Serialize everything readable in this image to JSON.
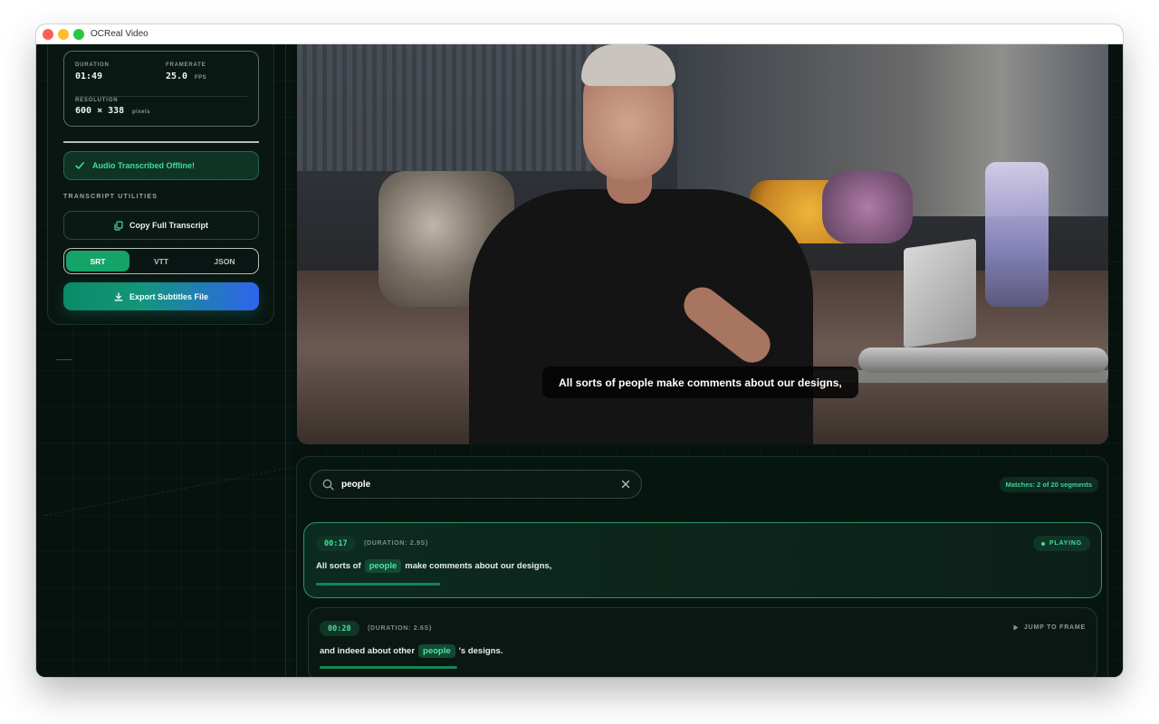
{
  "window": {
    "title": "OCReal Video",
    "accent": "#16a36a",
    "highlight_color": "#4be6a0"
  },
  "sidebar": {
    "metadata": {
      "duration_label": "DURATION",
      "duration_value": "01:49",
      "framerate_label": "FRAMERATE",
      "framerate_value": "25.0",
      "framerate_unit": "FPS",
      "resolution_label": "RESOLUTION",
      "resolution_value": "600 × 338",
      "resolution_unit": "pixels"
    },
    "status": {
      "icon": "check-icon",
      "text": "Audio Transcribed Offline!"
    },
    "utilities_title": "TRANSCRIPT UTILITIES",
    "copy_button": {
      "icon": "copy-icon",
      "label": "Copy Full Transcript"
    },
    "formats": {
      "options": [
        "SRT",
        "VTT",
        "JSON"
      ],
      "selected": "SRT"
    },
    "export_button": {
      "icon": "download-icon",
      "label": "Export Subtitles File"
    }
  },
  "video": {
    "current_subtitle": "All sorts of people make comments about our designs,"
  },
  "transcript": {
    "search": {
      "value": "people",
      "icon": "search-icon",
      "clear_icon": "close-icon"
    },
    "matches_text": "Matches: 2 of 20 segments",
    "segments": [
      {
        "timecode": "00:17",
        "duration": "(DURATION: 2.9S)",
        "text_before": "All sorts of",
        "match": "people",
        "text_after": "make comments about our designs,",
        "status": "PLAYING",
        "progress": 0.16
      },
      {
        "timecode": "00:20",
        "duration": "(DURATION: 2.6S)",
        "text_before": "and indeed about other",
        "match": "people",
        "text_after": "'s designs.",
        "action": "JUMP TO FRAME",
        "progress": 0.18
      }
    ]
  }
}
